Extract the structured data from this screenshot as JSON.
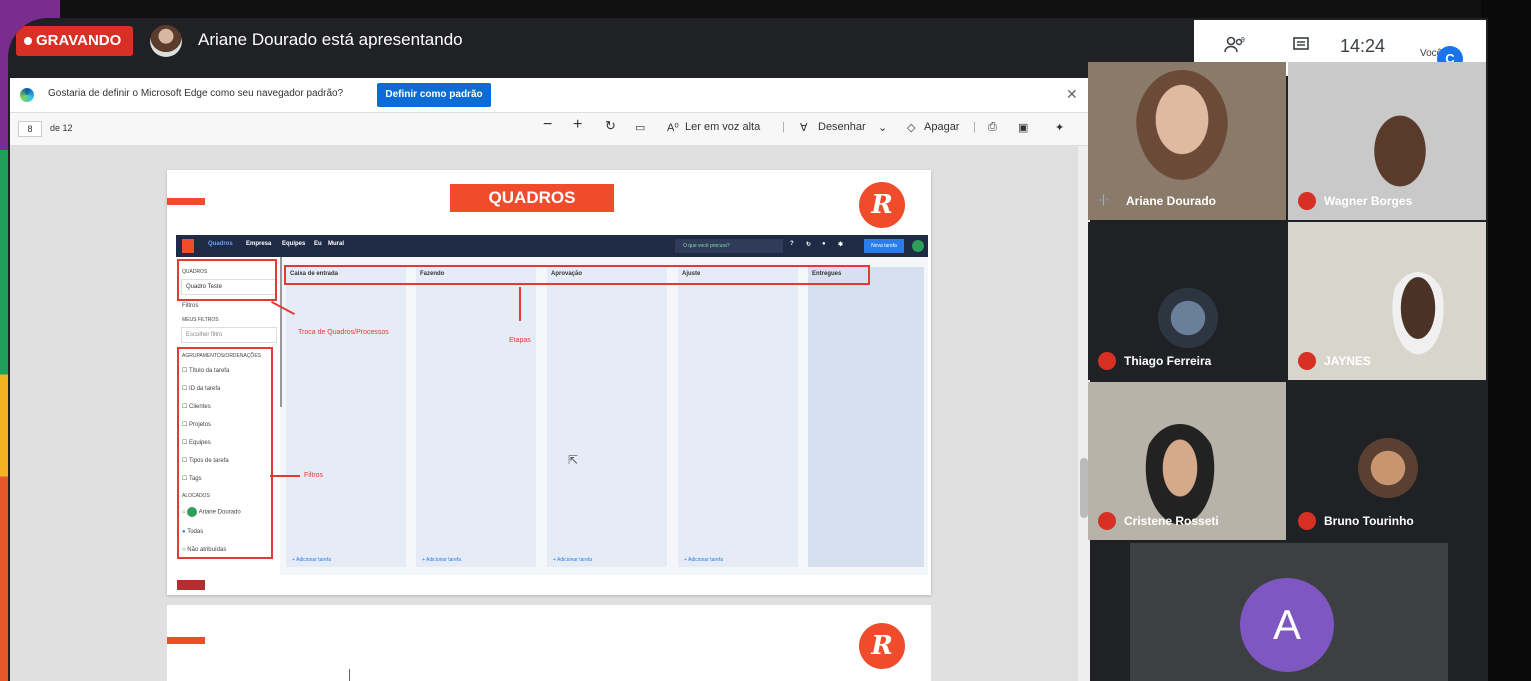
{
  "meet": {
    "recording_label": "GRAVANDO",
    "presenter_text": "Ariane Dourado está apresentando",
    "time": "14:24",
    "you_label": "Você",
    "you_initial": "C"
  },
  "edge": {
    "prompt": "Gostaria de definir o Microsoft Edge como seu navegador padrão?",
    "set_default_button": "Definir como padrão"
  },
  "pdf": {
    "page_number": "8",
    "page_total": "de 12",
    "read_aloud": "Ler em voz alta",
    "draw": "Desenhar",
    "erase": "Apagar"
  },
  "slide": {
    "title": "QUADROS",
    "logo_letter": "R",
    "app_nav": [
      "Quadros",
      "Empresa",
      "Equipes",
      "Eu",
      "Mural"
    ],
    "search_placeholder": "O que você procura?",
    "new_task": "Nova tarefa",
    "board_label": "QUADROS",
    "board_select": "Quadro Teste",
    "filters": "Filtros",
    "my_filters": "MEUS FILTROS",
    "choose_filter": "Escolher filtro",
    "group_label": "AGRUPAMENTOS/ORDENAÇÕES",
    "checks": [
      "Título da tarefa",
      "ID da tarefa",
      "Clientes",
      "Projetos",
      "Equipes",
      "Tipos de tarefa",
      "Tags"
    ],
    "allocated_label": "ALOCADOS",
    "allocated_user": "Ariane Dourado",
    "all_option": "Todas",
    "unassigned_option": "Não atribuídas",
    "columns": [
      "Caixa de entrada",
      "Fazendo",
      "Aprovação",
      "Ajuste",
      "Entregues"
    ],
    "add_task": "+ Adicionar tarefa",
    "annot_boards": "Troca de Quadros/Processos",
    "annot_stages": "Etapas",
    "annot_filters": "Filtros"
  },
  "participants": [
    {
      "name": "Ariane Dourado"
    },
    {
      "name": "Wagner Borges"
    },
    {
      "name": "Thiago Ferreira"
    },
    {
      "name": "JAYNES"
    },
    {
      "name": "Cristene Rosseti"
    },
    {
      "name": "Bruno Tourinho"
    }
  ],
  "big_avatar_letter": "A",
  "colors": {
    "accent": "#f04b2a",
    "record": "#d93025",
    "meet_bg": "#202124"
  }
}
